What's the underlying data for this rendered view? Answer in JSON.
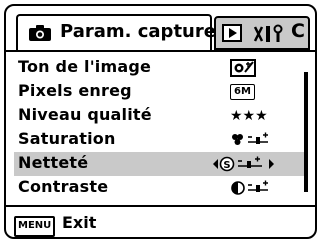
{
  "header": {
    "active_tab_title": "Param. capture",
    "right_tab_c": "C"
  },
  "icons": {
    "camera": "camera-icon",
    "playback": "playback-tab-icon",
    "setup": "setup-tab-icon"
  },
  "menu": {
    "items": [
      {
        "label": "Ton de l'image",
        "value_icon": "image-tone-icon"
      },
      {
        "label": "Pixels enreg",
        "value_text": "6M"
      },
      {
        "label": "Niveau qualité",
        "value_text": "★★★"
      },
      {
        "label": "Saturation",
        "value_icon": "saturation-slider"
      },
      {
        "label": "Netteté",
        "value_icon": "sharpness-slider",
        "selected": true
      },
      {
        "label": "Contraste",
        "value_icon": "contrast-slider"
      }
    ]
  },
  "footer": {
    "menu_key": "MENU",
    "exit_label": "Exit"
  }
}
